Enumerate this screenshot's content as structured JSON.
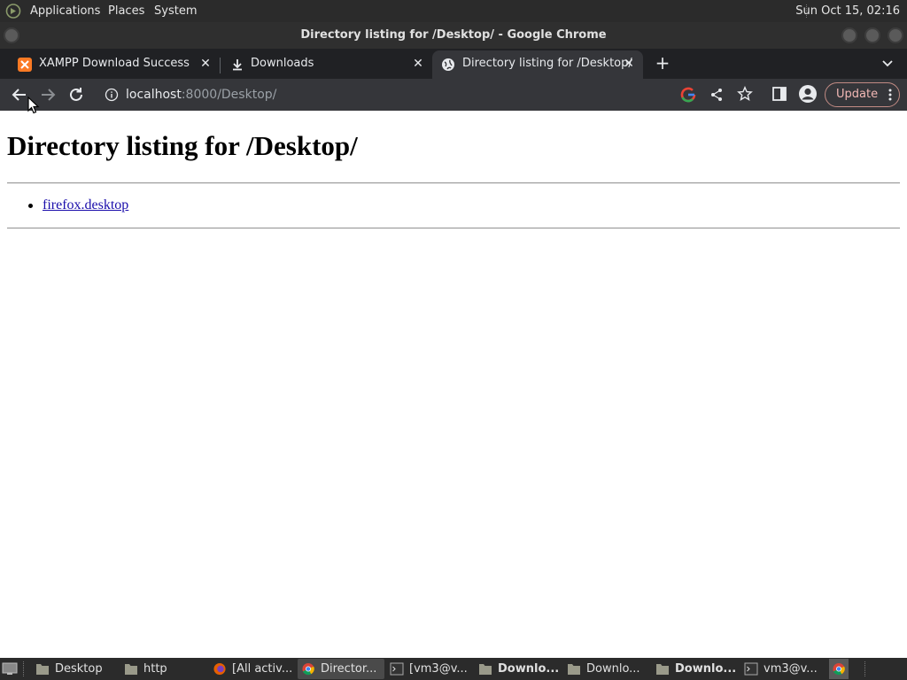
{
  "system_panel": {
    "menus": [
      "Applications",
      "Places",
      "System"
    ],
    "clock": "Sun Oct 15, 02:16"
  },
  "window": {
    "title": "Directory listing for /Desktop/ - Google Chrome"
  },
  "tabs": [
    {
      "label": "XAMPP Download Success",
      "icon": "xampp-icon",
      "active": false
    },
    {
      "label": "Downloads",
      "icon": "download-icon",
      "active": false
    },
    {
      "label": "Directory listing for /Desktop/",
      "icon": "globe-icon",
      "active": true
    }
  ],
  "toolbar": {
    "url_host": "localhost",
    "url_path": ":8000/Desktop/",
    "update_label": "Update"
  },
  "page": {
    "heading": "Directory listing for /Desktop/",
    "files": [
      "firefox.desktop"
    ]
  },
  "taskbar": {
    "items": [
      {
        "label": "Desktop",
        "icon": "folder-icon",
        "bold": false,
        "active": false
      },
      {
        "label": "http",
        "icon": "folder-icon",
        "bold": false,
        "active": false
      },
      {
        "label": "[All activ...",
        "icon": "firefox-icon",
        "bold": false,
        "active": false
      },
      {
        "label": "Director...",
        "icon": "chrome-icon",
        "bold": false,
        "active": true
      },
      {
        "label": "[vm3@v...",
        "icon": "terminal-icon",
        "bold": false,
        "active": false
      },
      {
        "label": "Downlo...",
        "icon": "folder-icon",
        "bold": true,
        "active": false
      },
      {
        "label": "Downlo...",
        "icon": "folder-icon",
        "bold": false,
        "active": false
      },
      {
        "label": "Downlo...",
        "icon": "folder-icon",
        "bold": true,
        "active": false
      },
      {
        "label": "vm3@v...",
        "icon": "terminal-icon",
        "bold": false,
        "active": false
      }
    ]
  },
  "colors": {
    "tab_strip_bg": "#202124",
    "toolbar_bg": "#35363a",
    "link": "#1a0dab",
    "update_accent": "#f2b8b5"
  }
}
